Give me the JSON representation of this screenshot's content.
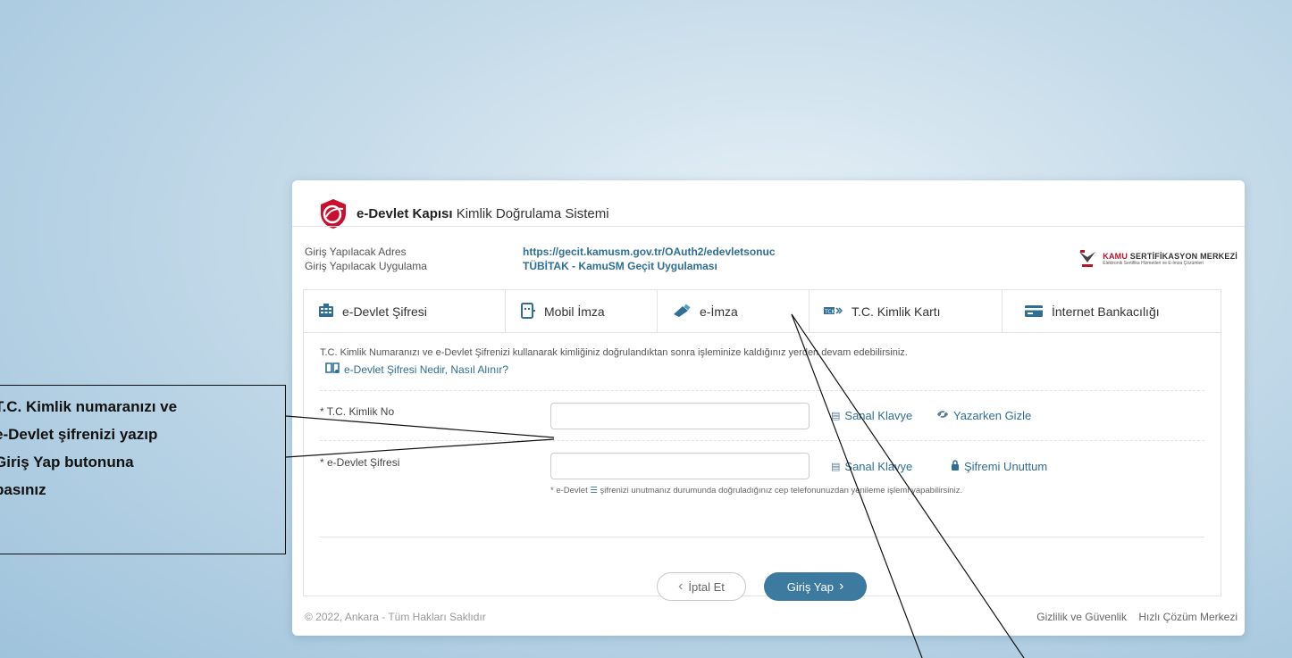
{
  "header": {
    "brand_bold": "e-Devlet Kapısı",
    "brand_rest": " Kimlik Doğrulama Sistemi"
  },
  "info": {
    "address_label": "Giriş Yapılacak Adres",
    "app_label": "Giriş Yapılacak Uygulama",
    "address_value": "https://gecit.kamusm.gov.tr/OAuth2/edevletsonuc",
    "app_value": "TÜBİTAK - KamuSM Geçit Uygulaması"
  },
  "kamusm": {
    "title_red": "KAMU",
    "title_rest": " SERTİFİKASYON MERKEZİ",
    "subtitle": "Elektronik Sertifika Hizmetleri ve E-İmza Çözümleri"
  },
  "tabs": [
    {
      "label": "e-Devlet Şifresi",
      "icon": "keypad-icon"
    },
    {
      "label": "Mobil İmza",
      "icon": "mobile-icon"
    },
    {
      "label": "e-İmza",
      "icon": "usb-token-icon"
    },
    {
      "label": "T.C. Kimlik Kartı",
      "icon": "id-card-icon"
    },
    {
      "label": "İnternet Bankacılığı",
      "icon": "bank-card-icon"
    }
  ],
  "panel": {
    "description": "T.C. Kimlik Numaranızı ve e-Devlet Şifrenizi kullanarak kimliğiniz doğrulandıktan sonra işleminize kaldığınız yerden devam edebilirsiniz.",
    "help_link": "e-Devlet Şifresi Nedir, Nasıl Alınır?",
    "tckn_label": "* T.C. Kimlik No",
    "tckn_value": "",
    "password_label": "* e-Devlet Şifresi",
    "password_value": "",
    "virtual_keyboard": "Sanal Klavye",
    "hide_while_typing": "Yazarken Gizle",
    "forgot_password": "Şifremi Unuttum",
    "note_prefix": "* e-Devlet",
    "note_rest": "şifrenizi unutmanız durumunda doğruladığınız cep telefonunuzdan yenileme işlemi yapabilirsiniz."
  },
  "buttons": {
    "cancel": "İptal Et",
    "login": "Giriş Yap"
  },
  "footer": {
    "copyright": "© 2022, Ankara - Tüm Hakları Saklıdır",
    "privacy": "Gizlilik ve Güvenlik",
    "help_center": "Hızlı Çözüm Merkezi"
  },
  "annotation": {
    "text": "T.C. Kimlik numaranızı ve\ne-Devlet şifrenizi yazıp\nGiriş Yap butonuna\nbasınız"
  },
  "colors": {
    "accent": "#3c7aa0",
    "brand_red": "#c8102e",
    "link": "#2f6f95"
  }
}
